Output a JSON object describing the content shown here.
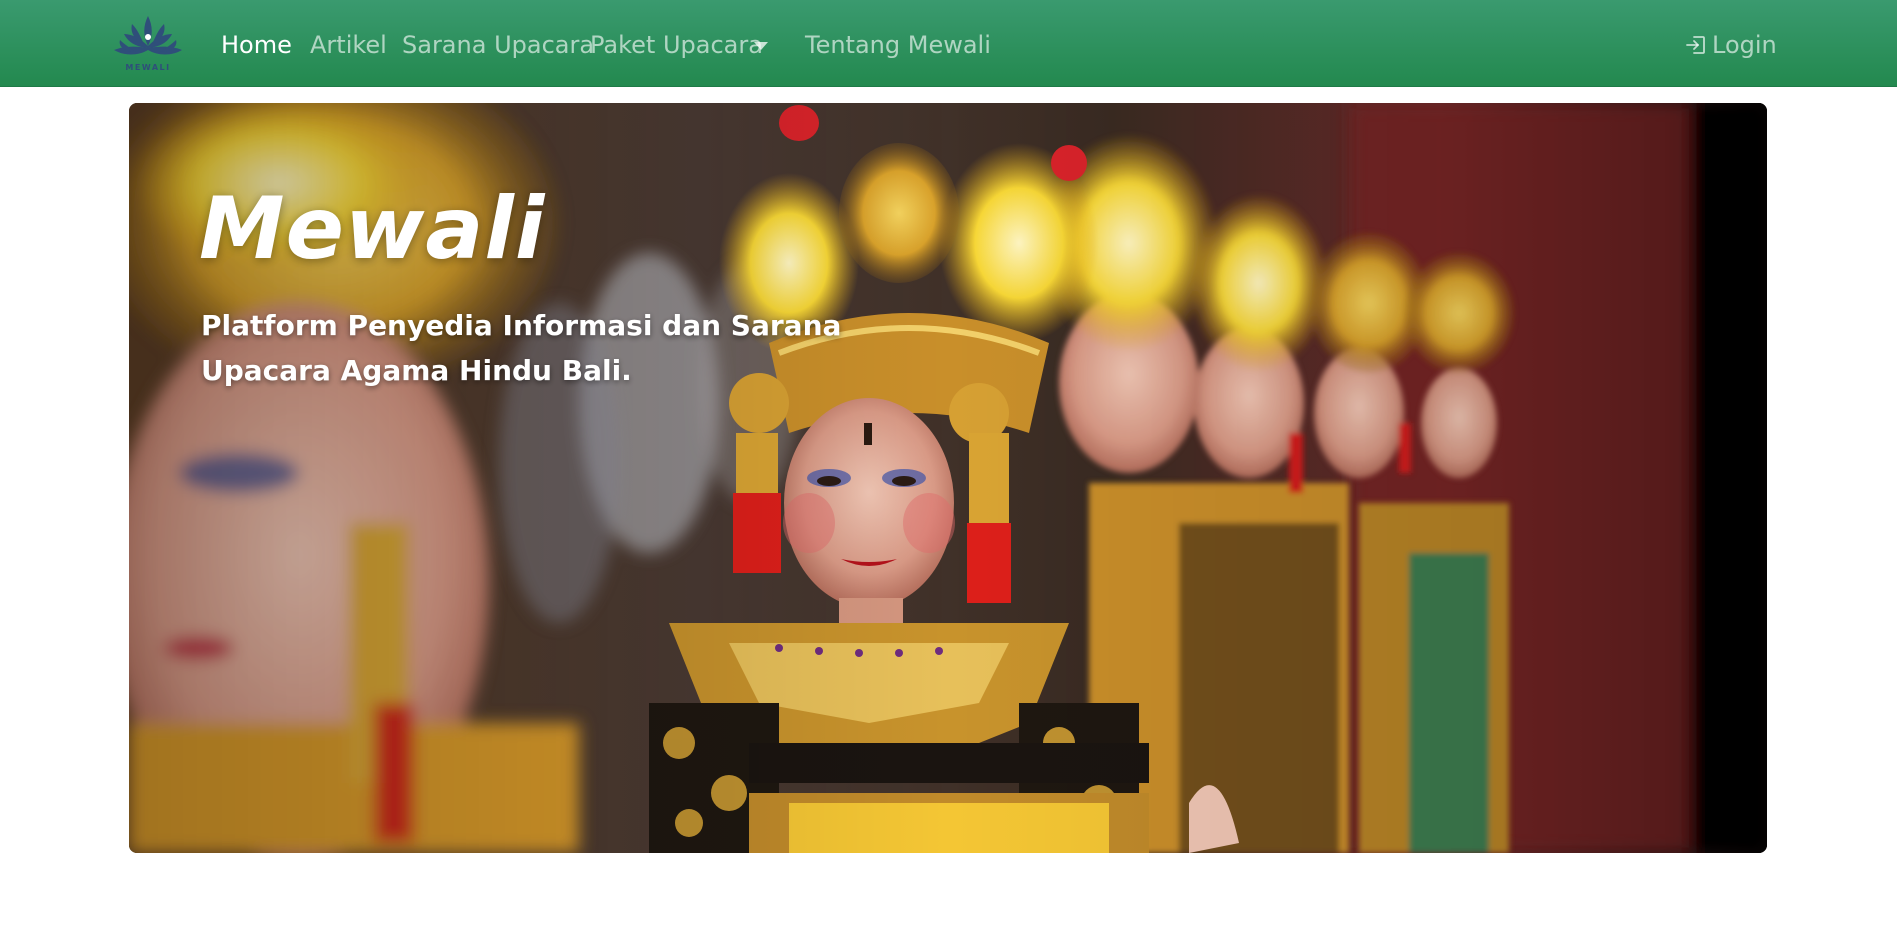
{
  "navbar": {
    "logo_text": "MEWALI",
    "links": [
      {
        "label": "Home",
        "active": true
      },
      {
        "label": "Artikel",
        "active": false
      },
      {
        "label": "Sarana Upacara",
        "active": false
      },
      {
        "label": "Paket Upacara",
        "active": false,
        "dropdown": true
      },
      {
        "label": "Tentang Mewali",
        "active": false
      }
    ],
    "login_label": "Login",
    "login_icon": "login-icon",
    "dropdown_icon": "caret-down-icon"
  },
  "hero": {
    "title": "Mewali",
    "subtitle": "Platform Penyedia Informasi dan Sarana Upacara Agama Hindu Bali.",
    "image_subject": "balinese-dancers-photo"
  },
  "colors": {
    "navbar": "#2e9160",
    "nav_text": "#ffffff",
    "logo": "#2f4f7a"
  }
}
